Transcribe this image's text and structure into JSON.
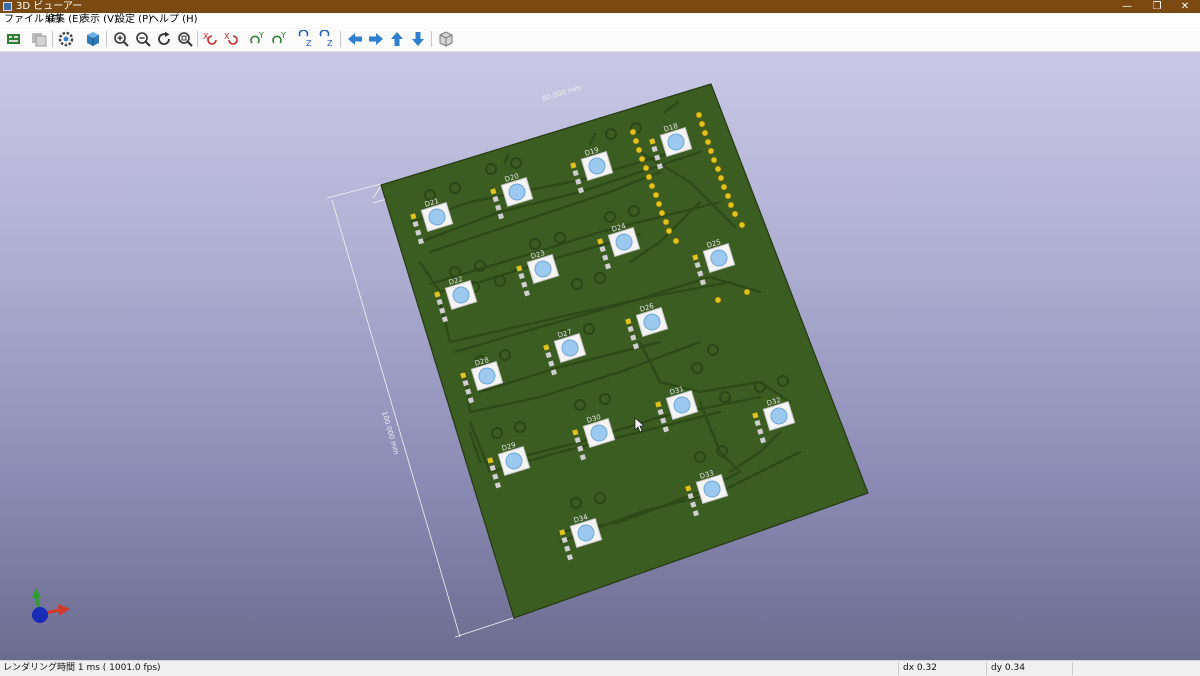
{
  "window": {
    "title": "3D ビューアー",
    "minimize": "—",
    "restore": "❐",
    "close": "✕"
  },
  "menu": [
    "ファイル (F)",
    "編集 (E)",
    "表示 (V)",
    "設定 (P)",
    "ヘルプ (H)"
  ],
  "toolbar": {
    "icons": [
      "reload-board-icon",
      "copy-image-icon",
      "render-options-icon",
      "3d-box-icon",
      "zoom-in-icon",
      "zoom-out-icon",
      "redraw-icon",
      "zoom-fit-icon",
      "rotate-x-cw-icon",
      "rotate-x-ccw-icon",
      "rotate-y-cw-icon",
      "rotate-y-ccw-icon",
      "rotate-z-cw-icon",
      "rotate-z-ccw-icon",
      "move-left-icon",
      "move-right-icon",
      "move-up-icon",
      "move-down-icon",
      "orthographic-icon"
    ]
  },
  "board": {
    "width_dimension": "80.000 mm",
    "height_dimension": "100.000 mm",
    "leds": [
      "D18",
      "D19",
      "D20",
      "D21",
      "D22",
      "D23",
      "D24",
      "D25",
      "D26",
      "D27",
      "D28",
      "D29",
      "D30",
      "D31",
      "D32",
      "D33",
      "D34"
    ],
    "colors": {
      "pcb": "#3c5d22",
      "copper_track": "#2d4a18",
      "pad": "#e3c31b",
      "led_lens": "#9cc9ef"
    }
  },
  "status": {
    "render_time": "レンダリング時間 1 ms ( 1001.0 fps)",
    "dx": "dx 0.32",
    "dy": "dy 0.34"
  }
}
